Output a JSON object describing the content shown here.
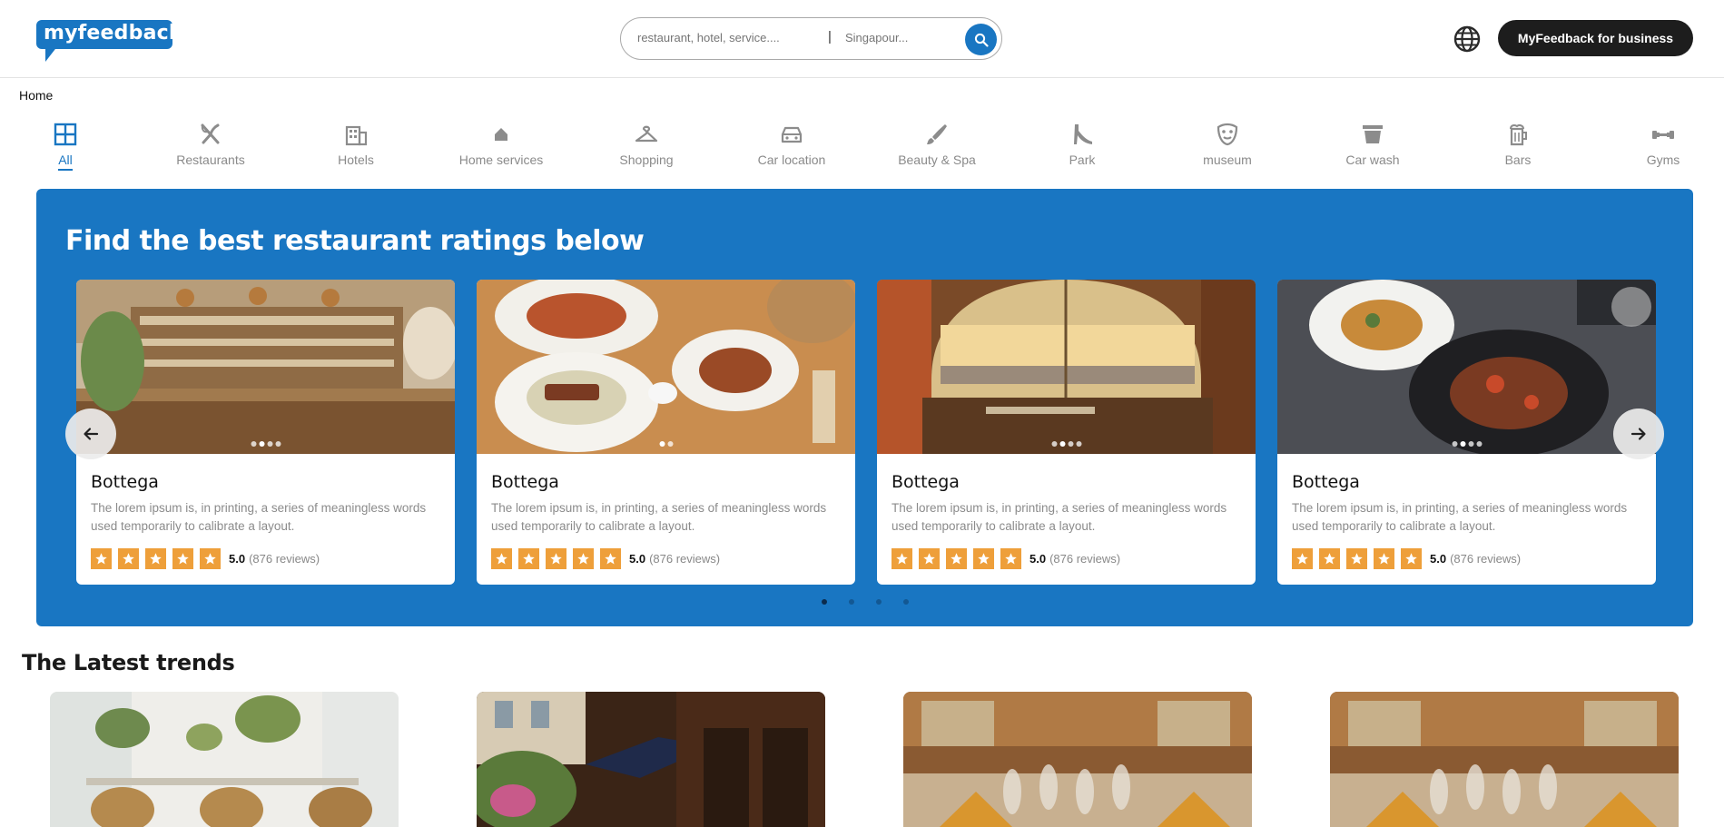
{
  "header": {
    "logo_text": "myfeedback",
    "search_what_placeholder": "restaurant, hotel, service....",
    "search_divider": "|",
    "search_where_placeholder": "Singapour...",
    "business_button": "MyFeedback for business"
  },
  "breadcrumb": "Home",
  "categories": [
    {
      "label": "All",
      "icon": "grid-icon",
      "active": true
    },
    {
      "label": "Restaurants",
      "icon": "utensils-icon"
    },
    {
      "label": "Hotels",
      "icon": "building-icon"
    },
    {
      "label": "Home services",
      "icon": "house-icon"
    },
    {
      "label": "Shopping",
      "icon": "hanger-icon"
    },
    {
      "label": "Car location",
      "icon": "car-icon"
    },
    {
      "label": "Beauty & Spa",
      "icon": "brush-icon"
    },
    {
      "label": "Park",
      "icon": "slide-icon"
    },
    {
      "label": "museum",
      "icon": "mask-icon"
    },
    {
      "label": "Car wash",
      "icon": "bucket-icon"
    },
    {
      "label": "Bars",
      "icon": "beer-icon"
    },
    {
      "label": "Gyms",
      "icon": "dumbbell-icon"
    }
  ],
  "banner": {
    "title": "Find the best restaurant ratings below",
    "cards": [
      {
        "name": "Bottega",
        "description": "The lorem ipsum is, in printing, a series of meaningless words used temporarily to calibrate a layout.",
        "score": "5.0",
        "reviews": "(876 reviews)",
        "stars": 5
      },
      {
        "name": "Bottega",
        "description": "The lorem ipsum is, in printing, a series of meaningless words used temporarily to calibrate a layout.",
        "score": "5.0",
        "reviews": "(876 reviews)",
        "stars": 5
      },
      {
        "name": "Bottega",
        "description": "The lorem ipsum is, in printing, a series of meaningless words used temporarily to calibrate a layout.",
        "score": "5.0",
        "reviews": "(876 reviews)",
        "stars": 5
      },
      {
        "name": "Bottega",
        "description": "The lorem ipsum is, in printing, a series of meaningless words used temporarily to calibrate a layout.",
        "score": "5.0",
        "reviews": "(876 reviews)",
        "stars": 5
      }
    ],
    "pager_active": 1,
    "pager_count": 4
  },
  "trends": {
    "title": "The Latest trends"
  },
  "colors": {
    "brand": "#1976c2",
    "star": "#ee9f3a",
    "dark_button": "#1d1d1d"
  }
}
